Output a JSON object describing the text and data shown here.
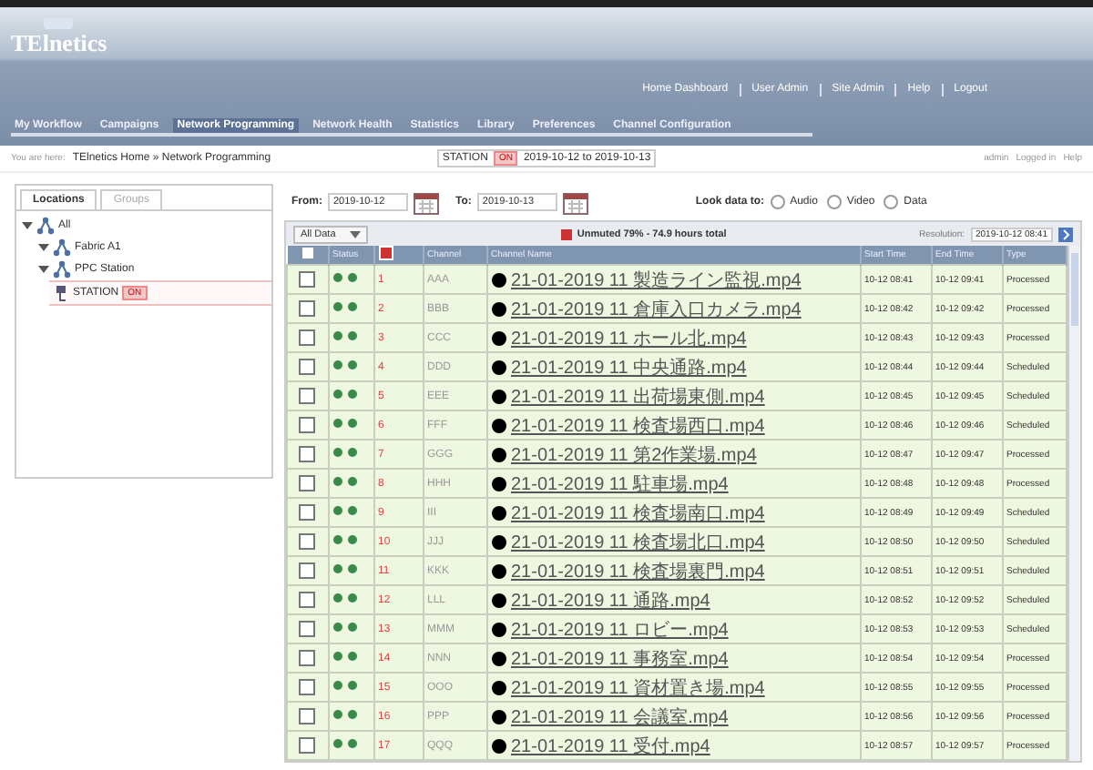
{
  "header": {
    "logo": "TElnetics",
    "links": [
      "Home Dashboard",
      "User Admin",
      "Site Admin",
      "Help",
      "Logout"
    ]
  },
  "nav": {
    "tabs": [
      {
        "label": "My Workflow",
        "selected": false
      },
      {
        "label": "Campaigns",
        "selected": false
      },
      {
        "label": "Network Programming",
        "selected": true
      },
      {
        "label": "Network Health",
        "selected": false
      },
      {
        "label": "Statistics",
        "selected": false
      },
      {
        "label": "Library",
        "selected": false
      },
      {
        "label": "Preferences",
        "selected": false
      },
      {
        "label": "Channel Configuration",
        "selected": false
      }
    ]
  },
  "breadcrumb": {
    "prefix": "You are here:",
    "path": "TElnetics Home » Network Programming",
    "station": "STATION",
    "badge": "ON",
    "range": "2019-10-12 to 2019-10-13",
    "user": "admin",
    "login": "Logged in",
    "help": "Help"
  },
  "sidebar": {
    "tabs": [
      {
        "label": "Locations",
        "selected": true
      },
      {
        "label": "Groups",
        "selected": false
      }
    ],
    "tree": [
      {
        "label": "All",
        "expanded": true,
        "children": [
          {
            "label": "Fabric A1",
            "expanded": true
          },
          {
            "label": "PPC Station",
            "expanded": true,
            "children": [
              {
                "label": "STATION",
                "badge": "ON",
                "selected": true
              }
            ]
          }
        ]
      }
    ]
  },
  "filters": {
    "from_label": "From:",
    "from": "2019-10-12",
    "to_label": "To:",
    "to": "2019-10-13",
    "look_label": "Look data to:",
    "options": [
      {
        "label": "Audio",
        "selected": false
      },
      {
        "label": "Video",
        "selected": false
      },
      {
        "label": "Data",
        "selected": false
      }
    ]
  },
  "toolbar": {
    "dropdown": "All Data",
    "alert": "Unmuted 79% - 74.9 hours total",
    "resolution_label": "Resolution:",
    "resolution": "2019-10-12 08:41"
  },
  "table": {
    "select_all_checked": false,
    "columns": [
      "",
      "Status",
      "",
      "Channel",
      "Channel Name",
      "Start Time",
      "End Time",
      "Type"
    ],
    "rows": [
      {
        "checked": false,
        "num": "1",
        "channel": "AAA",
        "name": "21-01-2019 11 製造ライン監視.mp4",
        "start": "10-12 08:41",
        "end": "10-12 09:41",
        "type": "Processed"
      },
      {
        "checked": false,
        "num": "2",
        "channel": "BBB",
        "name": "21-01-2019 11 倉庫入口カメラ.mp4",
        "start": "10-12 08:42",
        "end": "10-12 09:42",
        "type": "Processed"
      },
      {
        "checked": false,
        "num": "3",
        "channel": "CCC",
        "name": "21-01-2019 11 ホール北.mp4",
        "start": "10-12 08:43",
        "end": "10-12 09:43",
        "type": "Processed"
      },
      {
        "checked": false,
        "num": "4",
        "channel": "DDD",
        "name": "21-01-2019 11 中央通路.mp4",
        "start": "10-12 08:44",
        "end": "10-12 09:44",
        "type": "Scheduled"
      },
      {
        "checked": false,
        "num": "5",
        "channel": "EEE",
        "name": "21-01-2019 11 出荷場東側.mp4",
        "start": "10-12 08:45",
        "end": "10-12 09:45",
        "type": "Scheduled"
      },
      {
        "checked": false,
        "num": "6",
        "channel": "FFF",
        "name": "21-01-2019 11 検査場西口.mp4",
        "start": "10-12 08:46",
        "end": "10-12 09:46",
        "type": "Scheduled"
      },
      {
        "checked": false,
        "num": "7",
        "channel": "GGG",
        "name": "21-01-2019 11 第2作業場.mp4",
        "start": "10-12 08:47",
        "end": "10-12 09:47",
        "type": "Processed"
      },
      {
        "checked": false,
        "num": "8",
        "channel": "HHH",
        "name": "21-01-2019 11 駐車場.mp4",
        "start": "10-12 08:48",
        "end": "10-12 09:48",
        "type": "Processed"
      },
      {
        "checked": false,
        "num": "9",
        "channel": "III",
        "name": "21-01-2019 11 検査場南口.mp4",
        "start": "10-12 08:49",
        "end": "10-12 09:49",
        "type": "Scheduled"
      },
      {
        "checked": false,
        "num": "10",
        "channel": "JJJ",
        "name": "21-01-2019 11 検査場北口.mp4",
        "start": "10-12 08:50",
        "end": "10-12 09:50",
        "type": "Scheduled"
      },
      {
        "checked": false,
        "num": "11",
        "channel": "KKK",
        "name": "21-01-2019 11 検査場裏門.mp4",
        "start": "10-12 08:51",
        "end": "10-12 09:51",
        "type": "Scheduled"
      },
      {
        "checked": false,
        "num": "12",
        "channel": "LLL",
        "name": "21-01-2019 11 通路.mp4",
        "start": "10-12 08:52",
        "end": "10-12 09:52",
        "type": "Scheduled"
      },
      {
        "checked": false,
        "num": "13",
        "channel": "MMM",
        "name": "21-01-2019 11 ロビー.mp4",
        "start": "10-12 08:53",
        "end": "10-12 09:53",
        "type": "Scheduled"
      },
      {
        "checked": false,
        "num": "14",
        "channel": "NNN",
        "name": "21-01-2019 11 事務室.mp4",
        "start": "10-12 08:54",
        "end": "10-12 09:54",
        "type": "Processed"
      },
      {
        "checked": false,
        "num": "15",
        "channel": "OOO",
        "name": "21-01-2019 11 資材置き場.mp4",
        "start": "10-12 08:55",
        "end": "10-12 09:55",
        "type": "Processed"
      },
      {
        "checked": false,
        "num": "16",
        "channel": "PPP",
        "name": "21-01-2019 11 会議室.mp4",
        "start": "10-12 08:56",
        "end": "10-12 09:56",
        "type": "Processed"
      },
      {
        "checked": false,
        "num": "17",
        "channel": "QQQ",
        "name": "21-01-2019 11 受付.mp4",
        "start": "10-12 08:57",
        "end": "10-12 09:57",
        "type": "Processed"
      }
    ]
  }
}
